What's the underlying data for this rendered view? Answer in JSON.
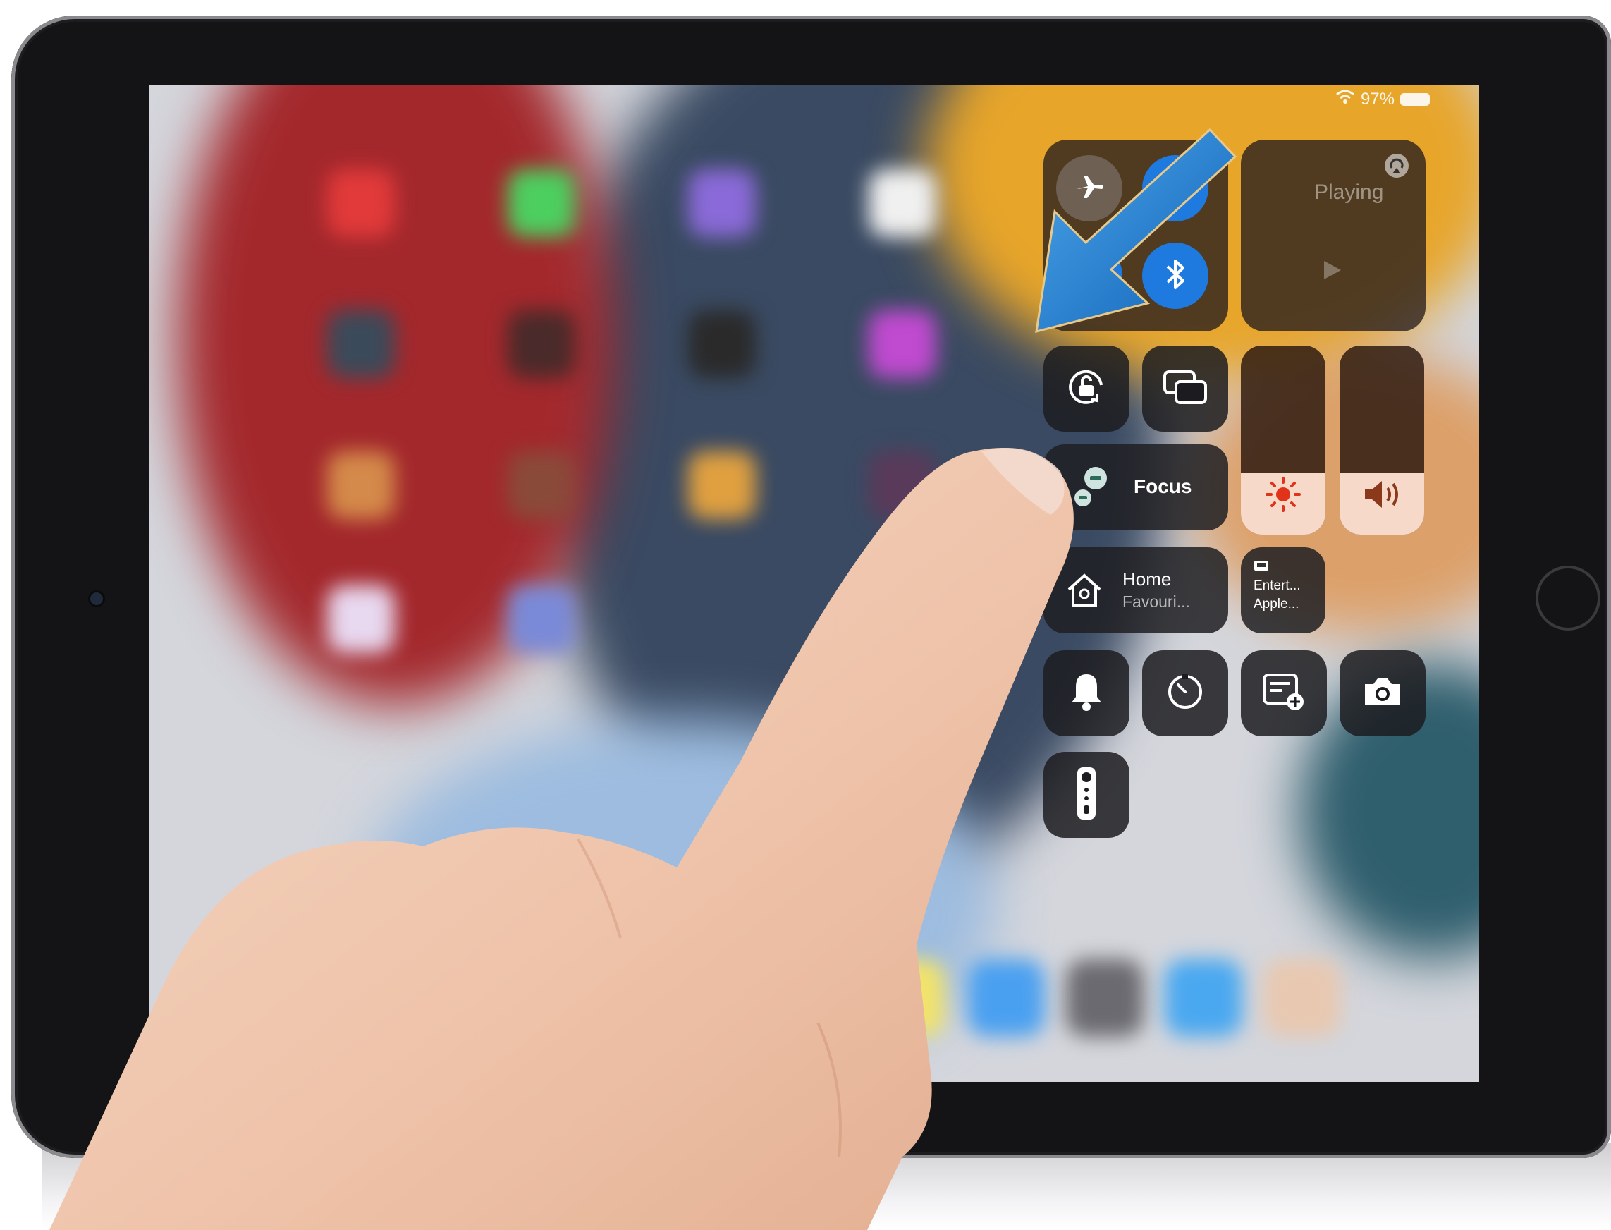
{
  "status_bar": {
    "battery": "97%"
  },
  "control_center": {
    "now_playing": {
      "label": "Playing"
    },
    "focus": {
      "label": "Focus"
    },
    "home": {
      "title": "Home",
      "subtitle": "Favouri..."
    },
    "apple_tv_remote_tile": {
      "line1": "Entert...",
      "line2": "Apple..."
    },
    "brightness_level": 0.33,
    "volume_level": 0.33,
    "connectivity": {
      "airplane_mode": false,
      "airdrop": true,
      "wifi": true,
      "bluetooth": true
    }
  },
  "colors": {
    "accent_blue": "#1f7ae0",
    "arrow_blue": "#1c7cd6",
    "slider_fill": "#f7d9c9"
  }
}
